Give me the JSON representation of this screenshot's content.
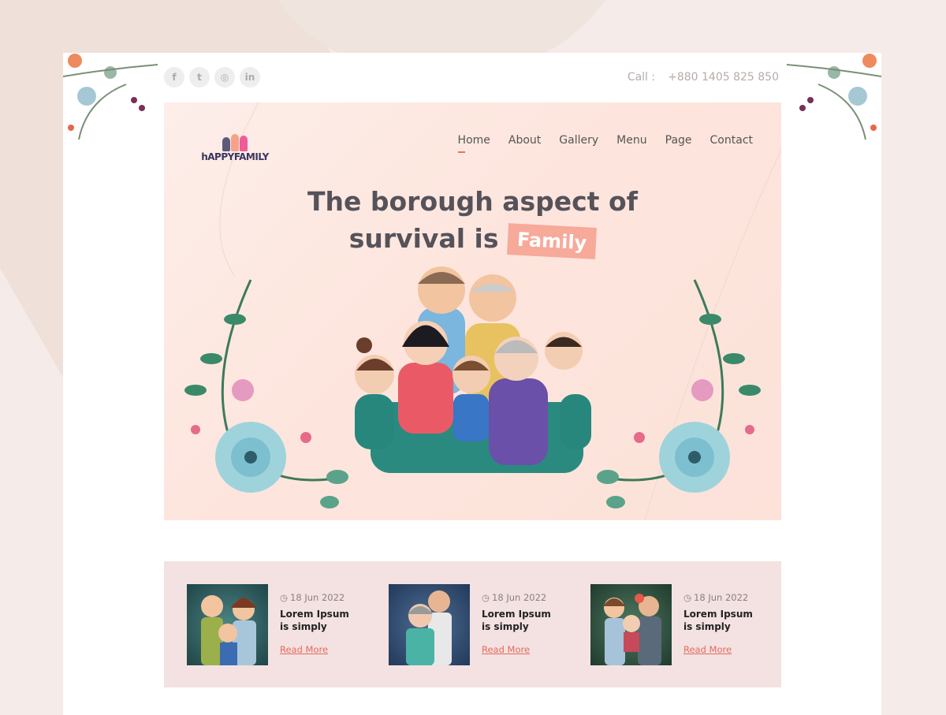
{
  "topbar": {
    "social": [
      {
        "name": "facebook",
        "glyph": "f"
      },
      {
        "name": "twitter",
        "glyph": "t"
      },
      {
        "name": "instagram",
        "glyph": "◎"
      },
      {
        "name": "linkedin",
        "glyph": "in"
      }
    ],
    "call_label": "Call :",
    "phone": "+880 1405 825 850"
  },
  "logo": {
    "text": "hAPPYFAMILY"
  },
  "nav": [
    {
      "label": "Home"
    },
    {
      "label": "About"
    },
    {
      "label": "Gallery"
    },
    {
      "label": "Menu"
    },
    {
      "label": "Page"
    },
    {
      "label": "Contact"
    }
  ],
  "hero": {
    "line1": "The borough aspect of",
    "line2": "survival is",
    "highlight": "Family"
  },
  "posts": [
    {
      "date": "18 Jun 2022",
      "title": "Lorem Ipsum is simply",
      "link": "Read More",
      "bg": "#2f5a5c"
    },
    {
      "date": "18 Jun 2022",
      "title": "Lorem Ipsum is simply",
      "link": "Read More",
      "bg": "#2e4f73"
    },
    {
      "date": "18 Jun 2022",
      "title": "Lorem Ipsum is simply",
      "link": "Read More",
      "bg": "#2f4d3e"
    }
  ],
  "colors": {
    "accent": "#e8755f",
    "badge": "#f7a99a",
    "hero_bg": "#fde8e2",
    "blog_bg": "#f3e2e1"
  }
}
